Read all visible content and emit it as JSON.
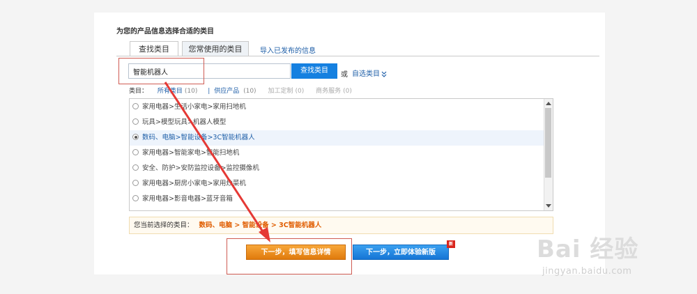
{
  "heading": "为您的产品信息选择合适的类目",
  "tabs": [
    {
      "label": "查找类目",
      "active": true
    },
    {
      "label": "您常使用的类目",
      "active": false
    }
  ],
  "import_link": "导入已发布的信息",
  "search": {
    "value": "智能机器人",
    "button": "查找类目"
  },
  "or_text": "或",
  "self_select": "自选类目",
  "self_select_icon": "double-chevron-down-icon",
  "filters": {
    "label": "类目：",
    "all": {
      "label": "所有类目",
      "count": "(10)"
    },
    "separator": "|",
    "supply": {
      "label": "供应产品",
      "count": "(10)"
    },
    "custom": {
      "label": "加工定制",
      "count": "(0)"
    },
    "service": {
      "label": "商务服务",
      "count": "(0)"
    }
  },
  "categories": [
    "家用电器>生活小家电>家用扫地机",
    "玩具>模型玩具>机器人模型",
    "数码、电脑>智能设备>3C智能机器人",
    "家用电器>智能家电>智能扫地机",
    "安全、防护>安防监控设备>监控摄像机",
    "家用电器>厨房小家电>家用炒菜机",
    "家用电器>影音电器>蓝牙音箱"
  ],
  "selected_index": 2,
  "current": {
    "label": "您当前选择的类目：",
    "path": "数码、电脑 > 智能设备 > 3C智能机器人"
  },
  "buttons": {
    "next_fill": "下一步，填写信息详情",
    "next_new": "下一步，立即体验新版",
    "new_badge": "新"
  },
  "watermark": {
    "brand": "Bai 经验",
    "url": "jingyan.baidu.com"
  },
  "colors": {
    "accent": "#1580e0",
    "orange": "#e07a0c",
    "annotation": "#cf5b52",
    "arrow": "#e53935"
  }
}
